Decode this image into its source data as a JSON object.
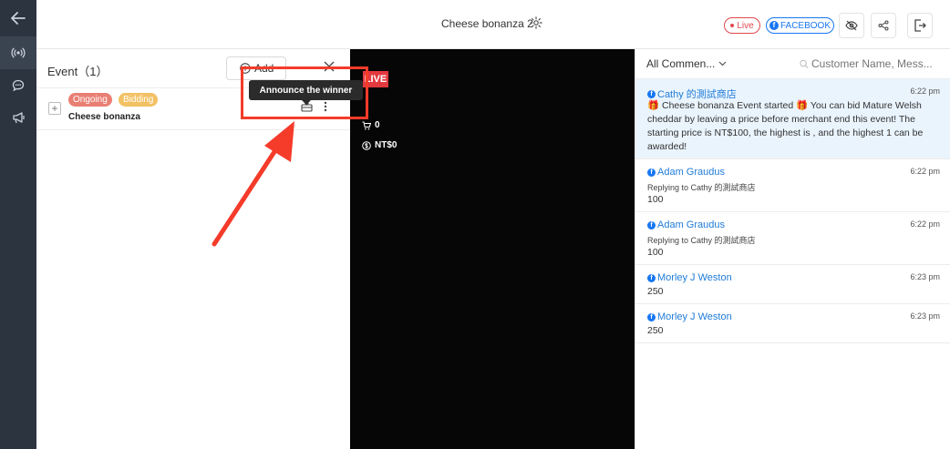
{
  "header": {
    "title": "Cheese bonanza 2",
    "live_label": "Live",
    "platform_label": "FACEBOOK"
  },
  "rail": {
    "icons": [
      "back-arrow-icon",
      "broadcast-icon",
      "chat-icon",
      "megaphone-icon"
    ]
  },
  "event_panel": {
    "title": "Event（1）",
    "add_label": "Add",
    "events": [
      {
        "tags": [
          "Ongoing",
          "Bidding"
        ],
        "name": "Cheese bonanza"
      }
    ],
    "tooltip": "Announce the winner"
  },
  "video": {
    "live_badge": "LIVE",
    "cart_count": "0",
    "amount": "NT$0"
  },
  "comments": {
    "filter_label": "All Commen...",
    "search_placeholder": "Customer Name, Mess...",
    "items": [
      {
        "name": "Cathy 的測試商店",
        "time": "6:22 pm",
        "reply": "",
        "body": "🎁 Cheese bonanza Event started 🎁 You can bid Mature Welsh cheddar by leaving a price before merchant end this event! The starting price is NT$100, the highest is , and the highest 1 can be awarded!"
      },
      {
        "name": "Adam Graudus",
        "time": "6:22 pm",
        "reply": "Replying to Cathy 的測試商店",
        "body": "100"
      },
      {
        "name": "Adam Graudus",
        "time": "6:22 pm",
        "reply": "Replying to Cathy 的測試商店",
        "body": "100"
      },
      {
        "name": "Morley J Weston",
        "time": "6:23 pm",
        "reply": "",
        "body": "250"
      },
      {
        "name": "Morley J Weston",
        "time": "6:23 pm",
        "reply": "",
        "body": "250"
      }
    ]
  },
  "colors": {
    "rail": "#2c3440",
    "live_red": "#e2393f",
    "facebook_blue": "#1877f2",
    "annotation_red": "#f53b2a",
    "tag_ongoing": "#e97f74",
    "tag_bidding": "#f2c164",
    "highlight_bg": "#eaf4fd"
  }
}
